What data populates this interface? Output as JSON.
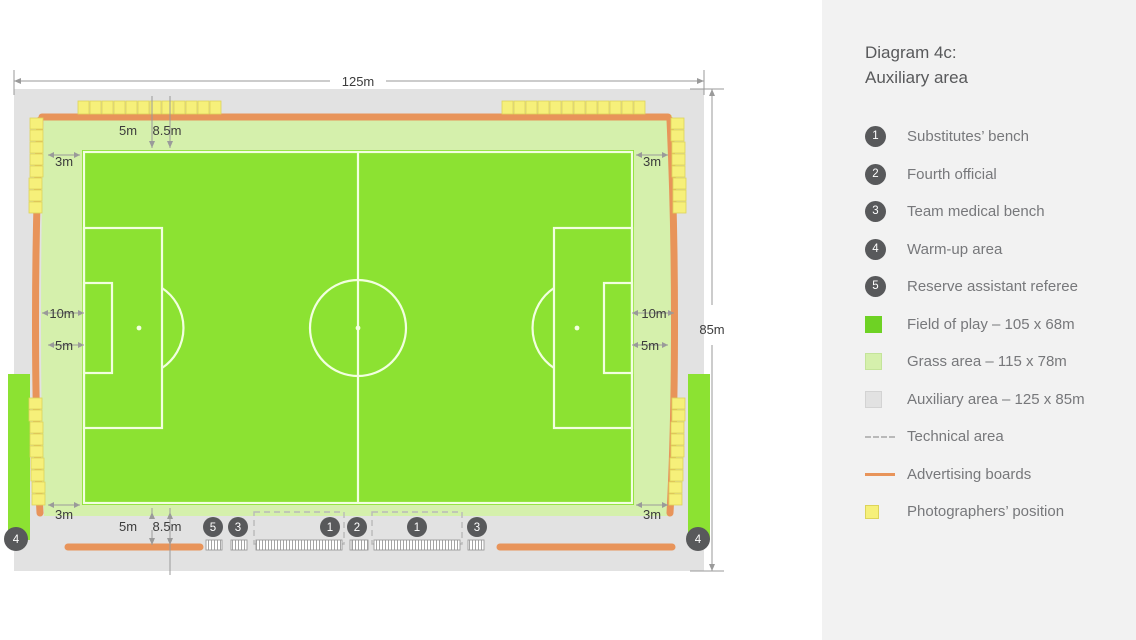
{
  "legend": {
    "title": "Diagram 4c:\nAuxiliary area",
    "numbered_items": [
      {
        "num": "1",
        "label": "Substitutes’ bench"
      },
      {
        "num": "2",
        "label": "Fourth official"
      },
      {
        "num": "3",
        "label": "Team medical bench"
      },
      {
        "num": "4",
        "label": "Warm-up area"
      },
      {
        "num": "5",
        "label": "Reserve assistant referee"
      }
    ],
    "key_items": [
      {
        "type": "swatch-field",
        "label": "Field of play – 105 x 68m"
      },
      {
        "type": "swatch-grass",
        "label": "Grass area – 115 x 78m"
      },
      {
        "type": "swatch-aux",
        "label": "Auxiliary area – 125 x 85m"
      },
      {
        "type": "dashed-line",
        "label": "Technical area"
      },
      {
        "type": "solid-line",
        "label": "Advertising boards"
      },
      {
        "type": "swatch-photo",
        "label": "Photographers’ position"
      }
    ]
  },
  "colors": {
    "field_of_play": "#6ed224",
    "grass_area": "#d5f0ac",
    "auxiliary_area": "#e2e2e2",
    "advertising_boards": "#e8945a",
    "photographers": "#f6f07a",
    "technical_area_dash": "#b9b9b9",
    "badge": "#58595b",
    "line_white": "#ffffff",
    "panel_bg": "#f2f2f2"
  },
  "dimensions": {
    "overall_width": "125m",
    "overall_height": "85m",
    "top_left_a": "5m",
    "top_left_b": "8.5m",
    "top_left_corner": "3m",
    "top_right_corner": "3m",
    "bottom_left_a": "5m",
    "bottom_left_b": "8.5m",
    "bottom_left_corner": "3m",
    "bottom_right_corner": "3m",
    "left_goal_10m": "10m",
    "left_goal_5m": "5m",
    "right_goal_10m": "10m",
    "right_goal_5m": "5m"
  },
  "pitch_badges": {
    "warmup_left": "4",
    "warmup_right": "4",
    "reserve_assistant": "5",
    "medical_left": "3",
    "subs_left": "1",
    "fourth_official_left": "2",
    "fourth_official_right": "2",
    "subs_right": "1",
    "medical_right": "3"
  },
  "chart_data": {
    "type": "diagram",
    "title": "Diagram 4c: Auxiliary area",
    "areas": [
      {
        "name": "Field of play",
        "size": "105 x 68m",
        "color": "#6ed224"
      },
      {
        "name": "Grass area",
        "size": "115 x 78m",
        "color": "#d5f0ac"
      },
      {
        "name": "Auxiliary area",
        "size": "125 x 85m",
        "color": "#e2e2e2"
      }
    ],
    "annotations": [
      "125m",
      "85m",
      "5m",
      "8.5m",
      "3m",
      "10m",
      "5m"
    ]
  }
}
